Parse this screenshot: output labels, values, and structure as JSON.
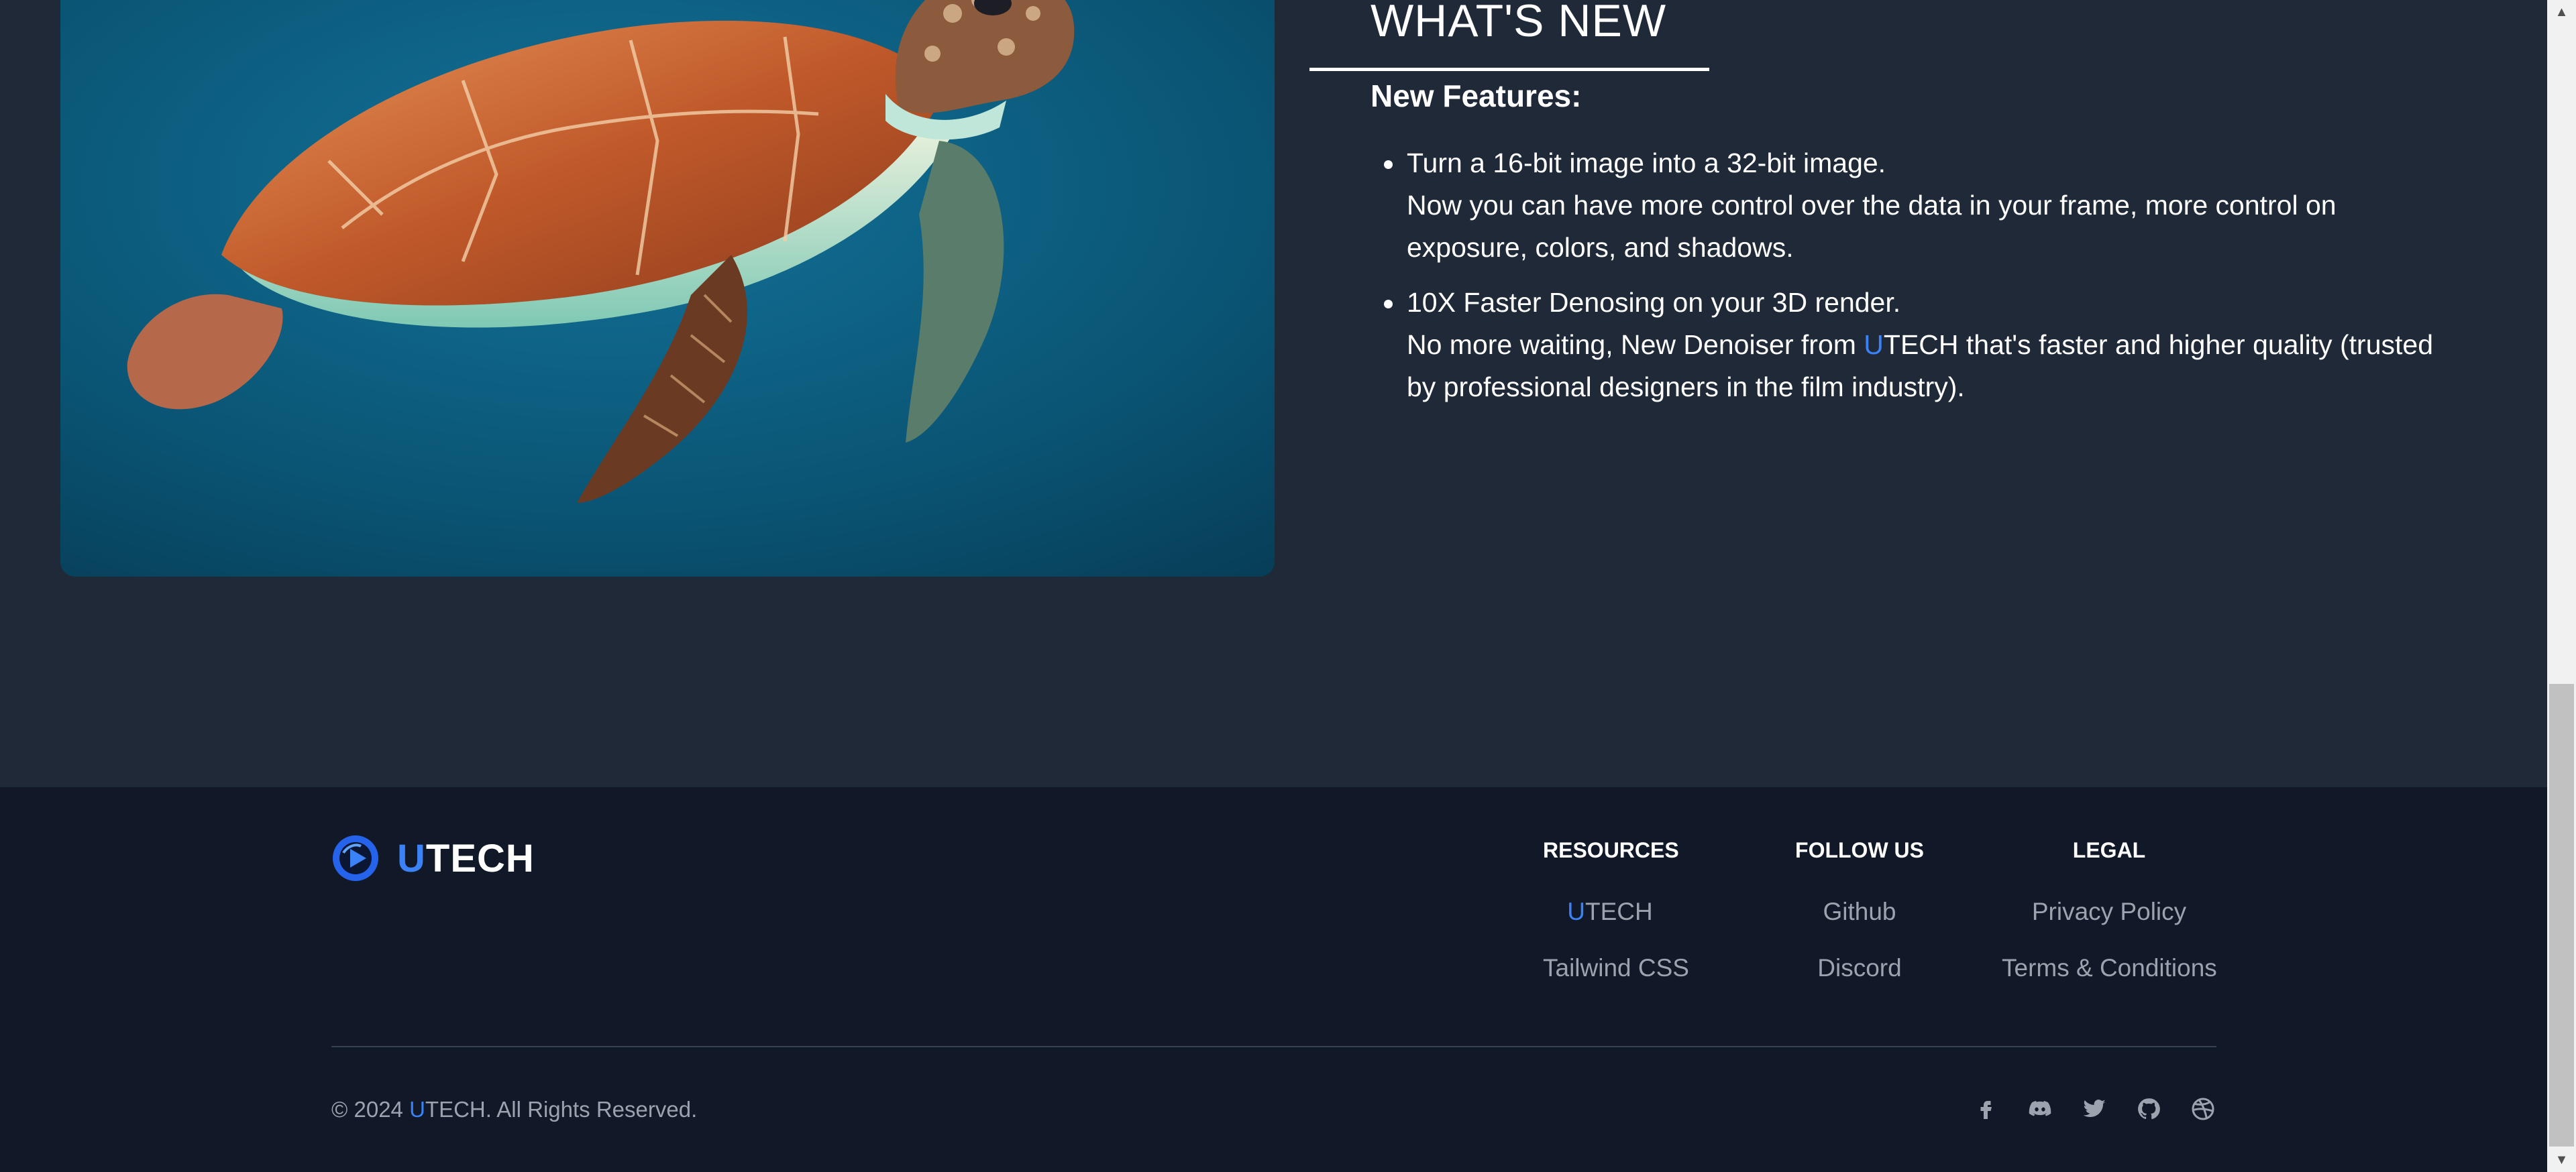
{
  "whats_new": {
    "title": "WHAT'S NEW",
    "subtitle": "New Features:",
    "features": [
      {
        "headline": "Turn a 16-bit image into a 32-bit image.",
        "line2": "Now you can have more control over the data in your frame, more control on",
        "line3": "exposure, colors, and shadows."
      },
      {
        "headline": "10X Faster Denosing on your 3D render.",
        "line2_before": "No more waiting, New Denoiser from ",
        "line2_brand_u": "U",
        "line2_brand_rest": "TECH",
        "line2_after": " that's faster and higher quality (trusted",
        "line3": "by professional designers in the film industry)."
      }
    ]
  },
  "footer": {
    "brand_u": "U",
    "brand_rest": "TECH",
    "columns": [
      {
        "heading": "RESOURCES",
        "links": [
          {
            "prefix": "U",
            "label": "TECH"
          },
          {
            "prefix": "",
            "label": "Tailwind CSS"
          }
        ]
      },
      {
        "heading": "FOLLOW US",
        "links": [
          {
            "prefix": "",
            "label": "Github"
          },
          {
            "prefix": "",
            "label": "Discord"
          }
        ]
      },
      {
        "heading": "LEGAL",
        "links": [
          {
            "prefix": "",
            "label": "Privacy Policy"
          },
          {
            "prefix": "",
            "label": "Terms & Conditions"
          }
        ]
      }
    ],
    "copyright_before": "© 2024 ",
    "copyright_brand_u": "U",
    "copyright_brand_rest": "TECH",
    "copyright_after": ". All Rights Reserved.",
    "social_icons": [
      "facebook-icon",
      "discord-icon",
      "twitter-icon",
      "github-icon",
      "dribbble-icon"
    ]
  },
  "colors": {
    "page_bg": "#1f2937",
    "footer_bg": "#111827",
    "brand_accent": "#3b82f6",
    "muted_text": "#9ca3af"
  }
}
